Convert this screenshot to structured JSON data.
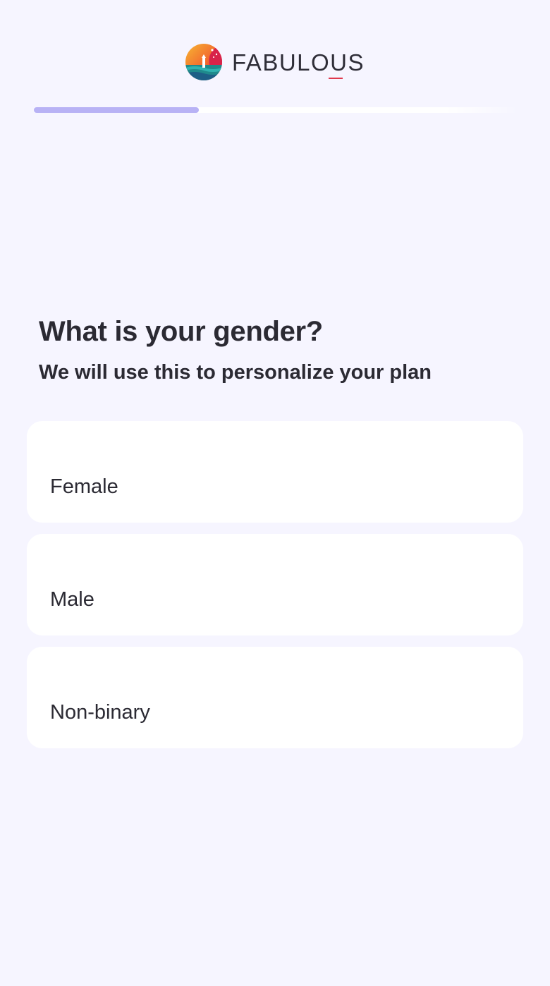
{
  "brand": {
    "name": "FABULOUS",
    "icon": "fabulous-logo-icon",
    "accent_color": "#e0394d"
  },
  "progress": {
    "value": 0.34,
    "fill_color": "#b8b2f5",
    "track_color": "#ffffff"
  },
  "question": {
    "title": "What is your gender?",
    "subtitle": "We will use this to personalize your plan"
  },
  "options": [
    {
      "label": "Female"
    },
    {
      "label": "Male"
    },
    {
      "label": "Non-binary"
    }
  ]
}
